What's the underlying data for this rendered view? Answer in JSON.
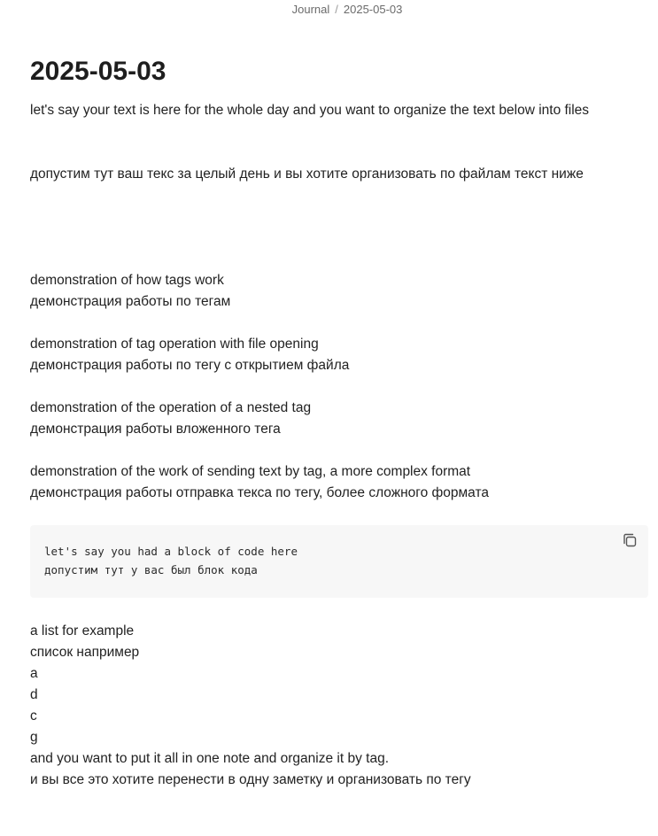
{
  "breadcrumb": {
    "parent": "Journal",
    "separator": "/",
    "current": "2025-05-03"
  },
  "note": {
    "title": "2025-05-03",
    "intro_en": "let's say your text is here for the whole day and you want to organize the text below into files",
    "intro_ru": "допустим тут ваш текс за целый день и вы хотите организовать по файлам текст ниже",
    "demos": [
      {
        "en": "demonstration of how tags work",
        "ru": "демонстрация работы по тегам"
      },
      {
        "en": "demonstration of tag operation with file opening",
        "ru": "демонстрация работы по тегу с открытием файла"
      },
      {
        "en": "demonstration of the operation of a nested tag",
        "ru": "демонстрация работы вложенного тега"
      },
      {
        "en": "demonstration of the work of sending text by tag, a more complex format",
        "ru": "демонстрация работы отправка текса по тегу,  более сложного формата"
      }
    ],
    "code_block": {
      "lines": [
        "let's say you had a block of code here",
        "допустим тут у вас был блок кода"
      ],
      "copy_icon": "copy-icon"
    },
    "list": [
      "a list for example",
      "список например",
      "a",
      "d",
      "c",
      "g"
    ],
    "outro_en": "and you want to put it all in one note and organize it by tag.",
    "outro_ru": "и вы все это хотите перенести в одну заметку и организовать по тегу"
  }
}
